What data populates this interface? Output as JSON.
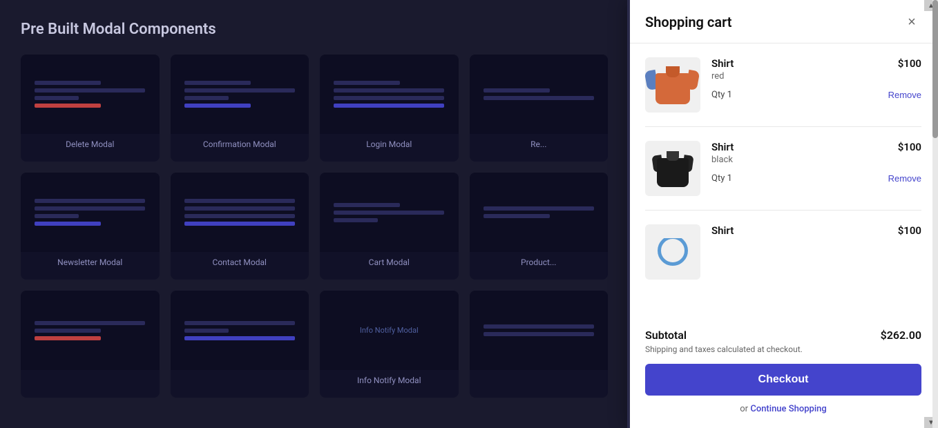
{
  "page": {
    "title": "Pre Built Modal Components"
  },
  "modalCards": [
    {
      "label": "Delete Modal"
    },
    {
      "label": "Confirmation Modal"
    },
    {
      "label": "Login Modal"
    },
    {
      "label": "Re..."
    },
    {
      "label": "Newsletter Modal"
    },
    {
      "label": "Contact Modal"
    },
    {
      "label": "Cart Modal"
    },
    {
      "label": "Product..."
    },
    {
      "label": ""
    },
    {
      "label": ""
    },
    {
      "label": "Info Notify Modal"
    },
    {
      "label": ""
    }
  ],
  "cart": {
    "title": "Shopping cart",
    "closeLabel": "×",
    "items": [
      {
        "name": "Shirt",
        "color": "red",
        "price": "$100",
        "qty": "Qty 1",
        "removeLabel": "Remove",
        "imageType": "red"
      },
      {
        "name": "Shirt",
        "color": "black",
        "price": "$100",
        "qty": "Qty 1",
        "removeLabel": "Remove",
        "imageType": "black"
      },
      {
        "name": "Shirt",
        "color": "",
        "price": "$100",
        "qty": "",
        "removeLabel": "",
        "imageType": "partial"
      }
    ],
    "subtotalLabel": "Subtotal",
    "subtotalValue": "$262.00",
    "shippingNote": "Shipping and taxes calculated at checkout.",
    "checkoutLabel": "Checkout",
    "continuePrefix": "or",
    "continueLinkLabel": "Continue Shopping"
  }
}
